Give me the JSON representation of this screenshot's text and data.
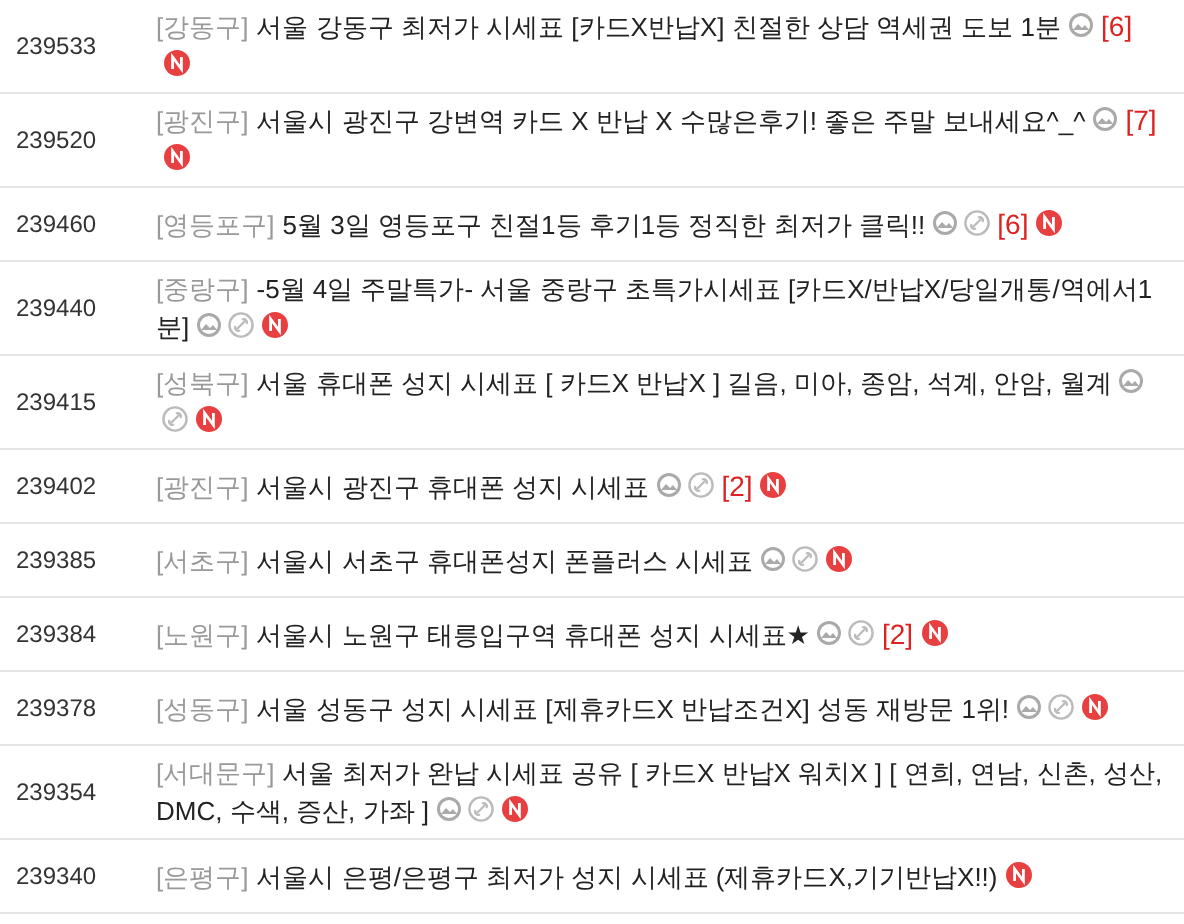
{
  "posts": [
    {
      "number": "239533",
      "region": "[강동구]",
      "title": "서울 강동구 최저가 시세표 [카드X반납X] 친절한 상담 역세권 도보 1분",
      "has_image": true,
      "has_link": false,
      "comments": "[6]",
      "is_new": true
    },
    {
      "number": "239520",
      "region": "[광진구]",
      "title": "서울시 광진구 강변역 카드 X 반납 X 수많은후기! 좋은 주말 보내세요^_^",
      "has_image": true,
      "has_link": false,
      "comments": "[7]",
      "is_new": true
    },
    {
      "number": "239460",
      "region": "[영등포구]",
      "title": "5월 3일 영등포구 친절1등 후기1등 정직한 최저가 클릭!!",
      "has_image": true,
      "has_link": true,
      "comments": "[6]",
      "is_new": true
    },
    {
      "number": "239440",
      "region": "[중랑구]",
      "title": "-5월 4일 주말특가- 서울 중랑구 초특가시세표 [카드X/반납X/당일개통/역에서1분]",
      "has_image": true,
      "has_link": true,
      "is_new": true
    },
    {
      "number": "239415",
      "region": "[성북구]",
      "title": "서울 휴대폰 성지 시세표 [ 카드X 반납X ] 길음, 미아, 종암, 석계, 안암, 월계",
      "has_image": true,
      "has_link": true,
      "is_new": true
    },
    {
      "number": "239402",
      "region": "[광진구]",
      "title": "서울시 광진구 휴대폰 성지 시세표",
      "has_image": true,
      "has_link": true,
      "comments": "[2]",
      "is_new": true
    },
    {
      "number": "239385",
      "region": "[서초구]",
      "title": "서울시 서초구 휴대폰성지 폰플러스 시세표",
      "has_image": true,
      "has_link": true,
      "is_new": true
    },
    {
      "number": "239384",
      "region": "[노원구]",
      "title": "서울시 노원구 태릉입구역 휴대폰 성지 시세표★",
      "has_image": true,
      "has_link": true,
      "comments": "[2]",
      "is_new": true
    },
    {
      "number": "239378",
      "region": "[성동구]",
      "title": "서울 성동구 성지 시세표 [제휴카드X 반납조건X] 성동 재방문 1위!",
      "has_image": true,
      "has_link": true,
      "is_new": true
    },
    {
      "number": "239354",
      "region": "[서대문구]",
      "title": "서울 최저가 완납 시세표 공유 [ 카드X 반납X 워치X ] [ 연희, 연남, 신촌, 성산, DMC, 수색, 증산, 가좌 ]",
      "has_image": true,
      "has_link": true,
      "is_new": true
    },
    {
      "number": "239340",
      "region": "[은평구]",
      "title": "서울시 은평/은평구 최저가 성지 시세표 (제휴카드X,기기반납X!!)",
      "has_image": false,
      "has_link": false,
      "is_new": true
    }
  ]
}
